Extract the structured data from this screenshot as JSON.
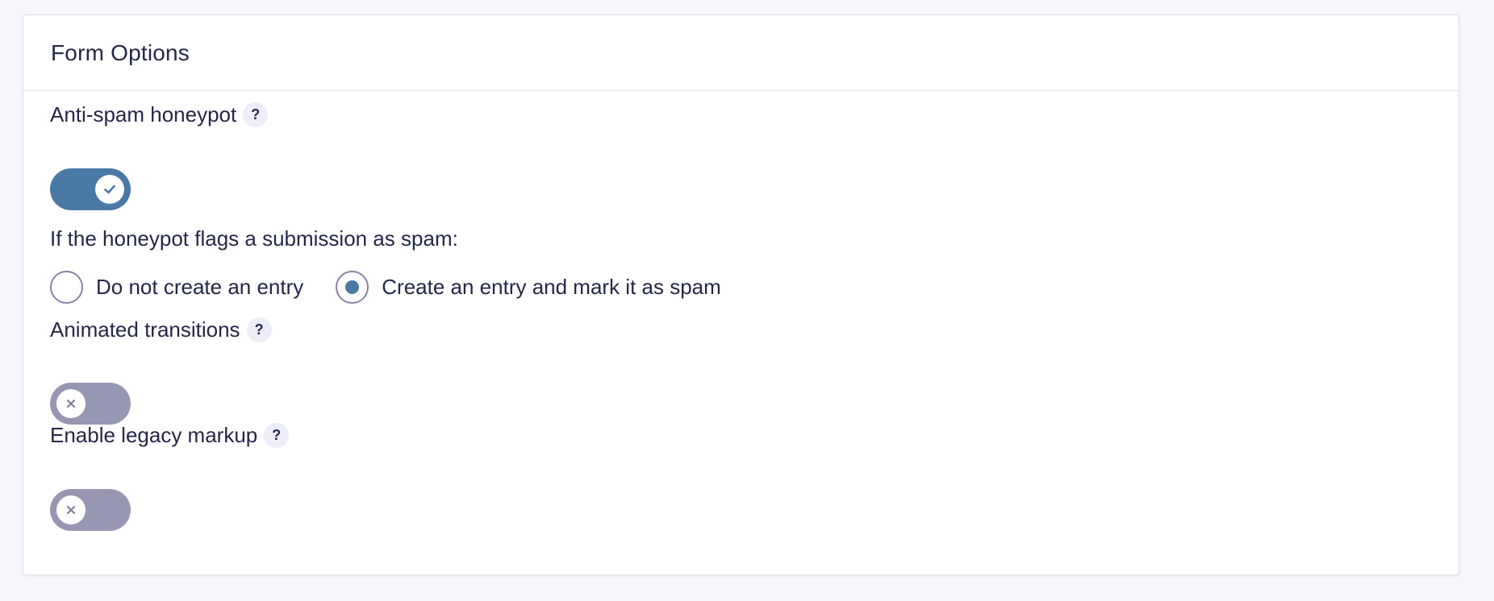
{
  "panel": {
    "title": "Form Options"
  },
  "settings": {
    "honeypot": {
      "label": "Anti-spam honeypot",
      "help": "?",
      "enabled": true
    },
    "spam_action": {
      "question": "If the honeypot flags a submission as spam:",
      "options": [
        {
          "label": "Do not create an entry",
          "selected": false
        },
        {
          "label": "Create an entry and mark it as spam",
          "selected": true
        }
      ]
    },
    "animated_transitions": {
      "label": "Animated transitions",
      "help": "?",
      "enabled": false
    },
    "legacy_markup": {
      "label": "Enable legacy markup",
      "help": "?",
      "enabled": false
    }
  },
  "icons": {
    "toggle_on": "check-icon",
    "toggle_off": "x-icon",
    "help": "question-icon"
  },
  "colors": {
    "toggle_on": "#4a79a6",
    "toggle_off": "#9797b3",
    "radio_selected": "#4a79a6",
    "text": "#242748",
    "page_background": "#f6f7fb"
  }
}
